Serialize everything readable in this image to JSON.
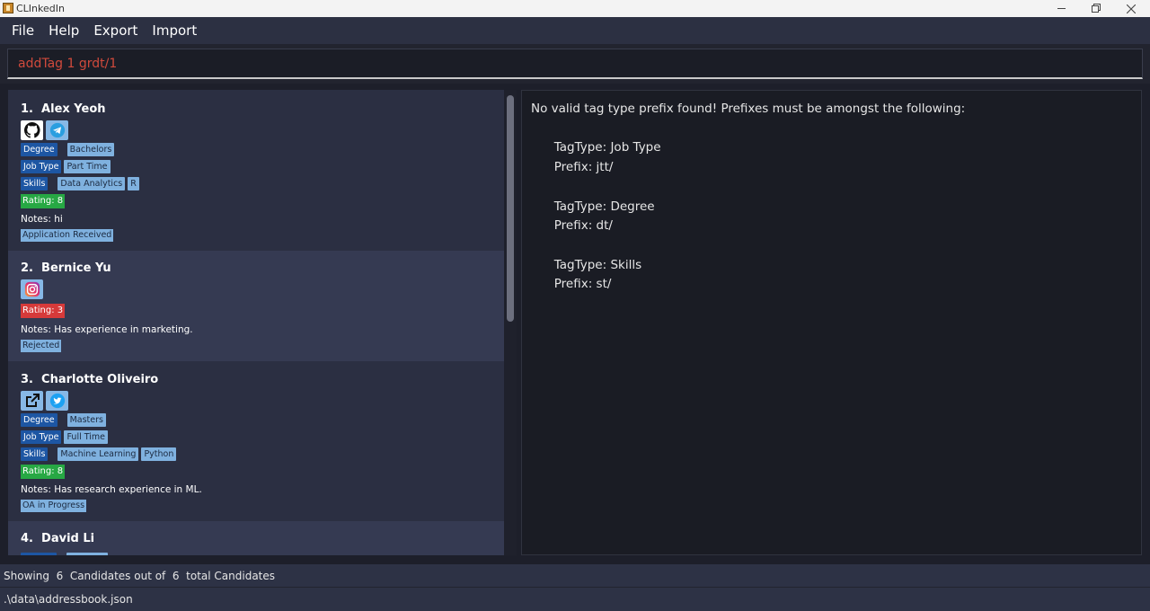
{
  "window": {
    "title": "CLInkedIn"
  },
  "menu": [
    "File",
    "Help",
    "Export",
    "Import"
  ],
  "command": {
    "value": "addTag 1 grdt/1"
  },
  "candidates": [
    {
      "index": "1.",
      "name": "Alex Yeoh",
      "links": [
        "github-icon",
        "telegram-icon"
      ],
      "tags": [
        {
          "type": "Degree",
          "values": [
            "Bachelors"
          ]
        },
        {
          "type": "Job Type",
          "values": [
            "Part Time"
          ]
        },
        {
          "type": "Skills",
          "values": [
            "Data Analytics",
            "R"
          ]
        }
      ],
      "rating": "Rating: 8",
      "rating_color": "#27a844",
      "notes": "Notes: hi",
      "status": "Application Received"
    },
    {
      "index": "2.",
      "name": "Bernice Yu",
      "links": [
        "instagram-icon"
      ],
      "tags": [],
      "rating": "Rating: 3",
      "rating_color": "#d63a3a",
      "notes": "Notes: Has experience in marketing.",
      "status": "Rejected"
    },
    {
      "index": "3.",
      "name": "Charlotte Oliveiro",
      "links": [
        "external-link-icon",
        "twitter-icon"
      ],
      "tags": [
        {
          "type": "Degree",
          "values": [
            "Masters"
          ]
        },
        {
          "type": "Job Type",
          "values": [
            "Full Time"
          ]
        },
        {
          "type": "Skills",
          "values": [
            "Machine Learning",
            "Python"
          ]
        }
      ],
      "rating": "Rating: 8",
      "rating_color": "#27a844",
      "notes": "Notes: Has research experience in ML.",
      "status": "OA in Progress"
    },
    {
      "index": "4.",
      "name": "David Li"
    }
  ],
  "result": {
    "message": "No valid tag type prefix found! Prefixes must be amongst the following:",
    "entries": [
      {
        "tagtype": "TagType: Job Type",
        "prefix": "Prefix: jtt/"
      },
      {
        "tagtype": "TagType: Degree",
        "prefix": "Prefix: dt/"
      },
      {
        "tagtype": "TagType: Skills",
        "prefix": "Prefix: st/"
      }
    ]
  },
  "status_bar": {
    "summary": "Showing  6  Candidates out of  6  total Candidates",
    "file_path": ".\\data\\addressbook.json"
  }
}
